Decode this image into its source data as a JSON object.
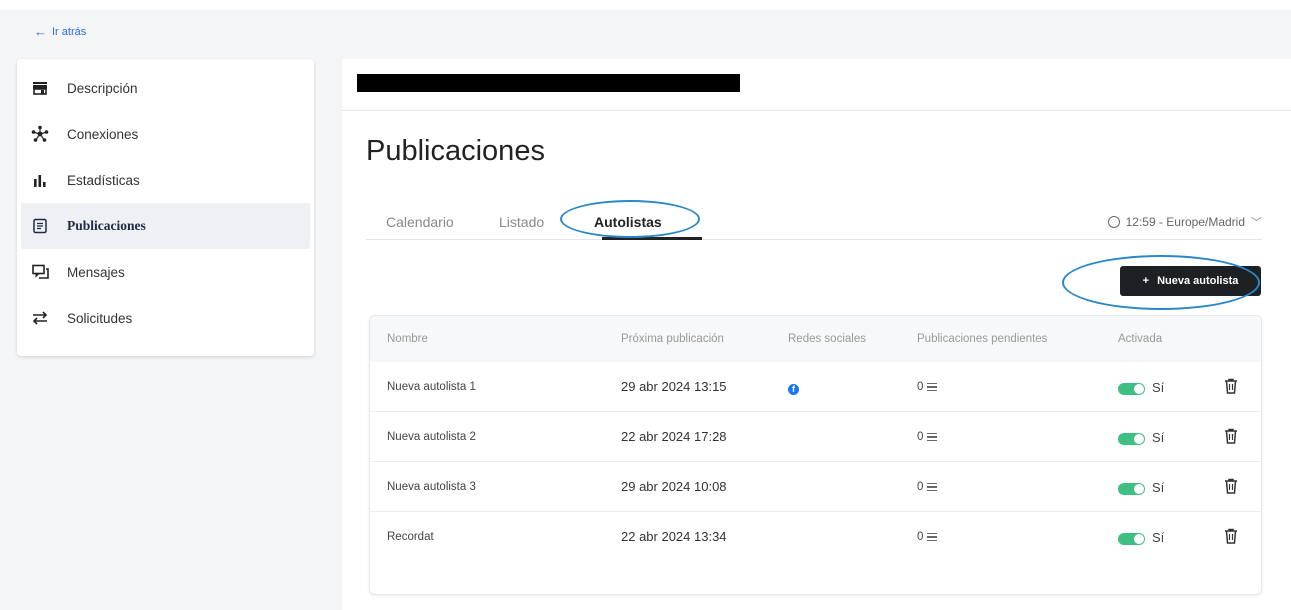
{
  "back": {
    "label": "Ir atrás",
    "icon": "arrow-left-icon"
  },
  "sidebar": {
    "items": [
      {
        "label": "Descripción",
        "icon": "store-icon",
        "active": false
      },
      {
        "label": "Conexiones",
        "icon": "network-icon",
        "active": false
      },
      {
        "label": "Estadísticas",
        "icon": "bar-chart-icon",
        "active": false
      },
      {
        "label": "Publicaciones",
        "icon": "document-icon",
        "active": true
      },
      {
        "label": "Mensajes",
        "icon": "chat-icon",
        "active": false
      },
      {
        "label": "Solicitudes",
        "icon": "swap-icon",
        "active": false
      }
    ]
  },
  "main": {
    "title": "Publicaciones",
    "tabs": [
      {
        "label": "Calendario",
        "active": false
      },
      {
        "label": "Listado",
        "active": false
      },
      {
        "label": "Autolistas",
        "active": true
      }
    ],
    "timezone": "12:59 - Europe/Madrid",
    "new_button": "Nueva autolista",
    "table": {
      "headers": [
        "Nombre",
        "Próxima publicación",
        "Redes sociales",
        "Publicaciones pendientes",
        "Activada"
      ],
      "rows": [
        {
          "name": "Nueva autolista 1",
          "next": "29 abr 2024 13:15",
          "network": "facebook",
          "pending": "0",
          "active": "Sí"
        },
        {
          "name": "Nueva autolista 2",
          "next": "22 abr 2024 17:28",
          "network": "",
          "pending": "0",
          "active": "Sí"
        },
        {
          "name": "Nueva autolista 3",
          "next": "29 abr 2024 10:08",
          "network": "",
          "pending": "0",
          "active": "Sí"
        },
        {
          "name": "Recordat",
          "next": "22 abr 2024 13:34",
          "network": "",
          "pending": "0",
          "active": "Sí"
        }
      ]
    }
  },
  "colors": {
    "accent_toggle": "#3fbf84",
    "annotation": "#2a88c9",
    "button_dark": "#1e2124",
    "facebook": "#1877f2"
  }
}
